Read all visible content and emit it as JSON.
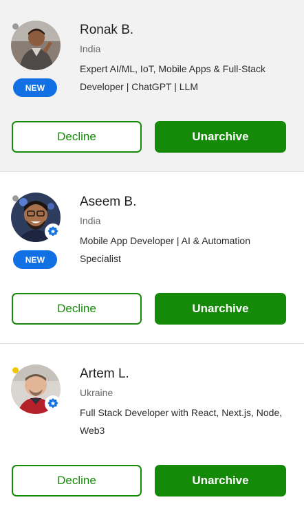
{
  "colors": {
    "brand_green": "#148a08",
    "new_badge_blue": "#1170e3",
    "selected_card_bg": "#f2f2f2",
    "offline_dot": "#9a9a9a",
    "away_dot": "#f0c808"
  },
  "freelancers": [
    {
      "name": "Ronak B.",
      "country": "India",
      "title": "Expert AI/ML, IoT, Mobile Apps & Full-Stack Developer | ChatGPT | LLM",
      "badge": "NEW",
      "status": "offline",
      "verified_icon": "",
      "decline_label": "Decline",
      "unarchive_label": "Unarchive"
    },
    {
      "name": "Aseem B.",
      "country": "India",
      "title": "Mobile App Developer | AI & Automation Specialist",
      "badge": "NEW",
      "status": "offline",
      "verified_icon": "shield-star-icon",
      "decline_label": "Decline",
      "unarchive_label": "Unarchive"
    },
    {
      "name": "Artem L.",
      "country": "Ukraine",
      "title": "Full Stack Developer with React, Next.js, Node, Web3",
      "badge": "",
      "status": "away",
      "verified_icon": "shield-star-icon",
      "decline_label": "Decline",
      "unarchive_label": "Unarchive"
    }
  ]
}
